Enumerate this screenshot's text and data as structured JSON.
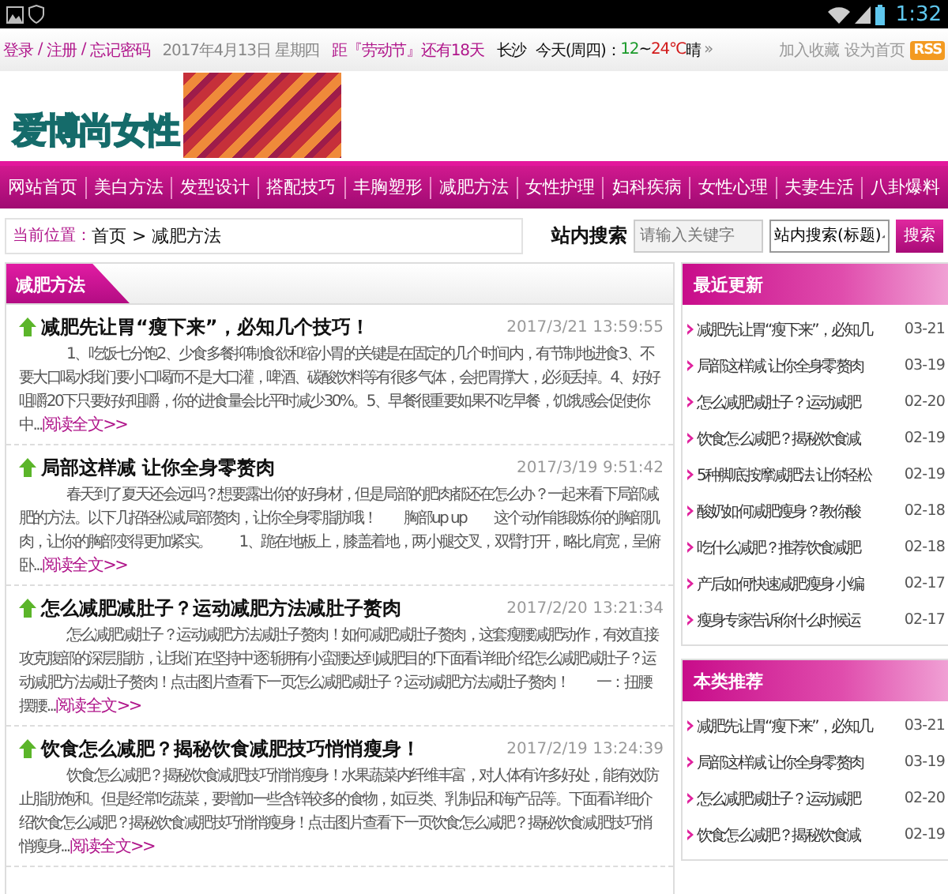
{
  "status_bar": {
    "time": "1:32"
  },
  "top_bar": {
    "account_links": [
      "登录",
      "注册",
      "忘记密码"
    ],
    "separator": "/",
    "date": "2017年4月13日 星期四",
    "countdown": "距『劳动节』还有18天",
    "weather": {
      "city": "长沙",
      "day": "今天(周四)：",
      "low": "12",
      "tilde": "~",
      "high": "24℃",
      "condition": "晴",
      "more": "»"
    },
    "right_links": [
      "加入收藏",
      "设为首页"
    ],
    "rss": "RSS"
  },
  "header": {
    "logo": "爱博尚女性"
  },
  "nav": [
    "网站首页",
    "美白方法",
    "发型设计",
    "搭配技巧",
    "丰胸塑形",
    "减肥方法",
    "女性护理",
    "妇科疾病",
    "女性心理",
    "夫妻生活",
    "八卦爆料"
  ],
  "breadcrumb": {
    "label": "当前位置：",
    "path": "首页 > 减肥方法"
  },
  "search": {
    "label": "站内搜索",
    "placeholder": "请输入关键字",
    "scope": "站内搜索(标题)",
    "button": "搜索"
  },
  "main_panel": {
    "title": "减肥方法",
    "articles": [
      {
        "title": "减肥先让胃“瘦下来”，必知几个技巧！",
        "date": "2017/3/21 13:59:55",
        "body": "1、吃饭七分饱2、少食多餐抑制食欲和缩小胃的关键是在固定的几个时间内，有节制地进食3、不要大口喝水我们要小口喝而不是大口灌，啤酒、碳酸饮料等有很多气体，会把胃撑大，必须丢掉。4、好好咀嚼20下只要好好咀嚼，你的进食量会比平时减少30%。5、早餐很重要如果不吃早餐，饥饿感会促使你中...",
        "more": "阅读全文>>"
      },
      {
        "title": "局部这样减 让你全身零赘肉",
        "date": "2017/3/19 9:51:42",
        "body": "春天到了夏天还会远吗？想要露出你的好身材，但是局部的肥肉都还在怎么办？一起来看下局部减肥的方法。以下几招轻松减局部赘肉，让你全身零脂肪哦！　　胸部up up　　这个动作能锻炼你的胸部肌肉，让你的胸部变得更加紧实。　　1、跪在地板上，膝盖着地，两小腿交叉，双臂打开，略比肩宽，呈俯卧...",
        "more": "阅读全文>>"
      },
      {
        "title": "怎么减肥减肚子？运动减肥方法减肚子赘肉",
        "date": "2017/2/20 13:21:34",
        "body": "怎么减肥减肚子？运动减肥方法减肚子赘肉！如何减肥减肚子赘肉，这套瘦腰减肥动作，有效直接攻克腹部的深层脂肪，让我们在坚持中逐渐拥有小蛮腰达到减肥目的!下面看详细介绍怎么减肥减肚子？运动减肥方法减肚子赘肉！点击图片查看下一页怎么减肥减肚子？运动减肥方法减肚子赘肉！　　一：扭腰摆腰...",
        "more": "阅读全文>>"
      },
      {
        "title": "饮食怎么减肥？揭秘饮食减肥技巧悄悄瘦身！",
        "date": "2017/2/19 13:24:39",
        "body": "饮食怎么减肥？揭秘饮食减肥技巧悄悄瘦身！水果蔬菜内纤维丰富，对人体有许多好处，能有效防止脂肪饱和。但是经常吃蔬菜，要增加一些含锌较多的食物，如豆类、乳制品和海产品等。下面看详细介绍饮食怎么减肥？揭秘饮食减肥技巧悄悄瘦身！点击图片查看下一页饮食怎么减肥？揭秘饮食减肥技巧悄悄瘦身...",
        "more": "阅读全文>>"
      }
    ]
  },
  "sidebar": [
    {
      "title": "最近更新",
      "items": [
        {
          "title": "减肥先让胃“瘦下来”，必知几",
          "date": "03-21"
        },
        {
          "title": "局部这样减 让你全身零赘肉",
          "date": "03-19"
        },
        {
          "title": "怎么减肥减肚子？运动减肥",
          "date": "02-20"
        },
        {
          "title": "饮食怎么减肥？揭秘饮食减",
          "date": "02-19"
        },
        {
          "title": "5种脚底按摩减肥法 让你轻松",
          "date": "02-19"
        },
        {
          "title": "酸奶如何减肥瘦身？教你酸",
          "date": "02-18"
        },
        {
          "title": "吃什么减肥？推荐饮食减肥",
          "date": "02-18"
        },
        {
          "title": "产后如何快速减肥瘦身 小编",
          "date": "02-17"
        },
        {
          "title": "瘦身专家告诉你什么时候运",
          "date": "02-17"
        }
      ]
    },
    {
      "title": "本类推荐",
      "items": [
        {
          "title": "减肥先让胃“瘦下来”，必知几",
          "date": "03-21"
        },
        {
          "title": "局部这样减 让你全身零赘肉",
          "date": "03-19"
        },
        {
          "title": "怎么减肥减肚子？运动减肥",
          "date": "02-20"
        },
        {
          "title": "饮食怎么减肥？揭秘饮食减",
          "date": "02-19"
        }
      ]
    }
  ]
}
